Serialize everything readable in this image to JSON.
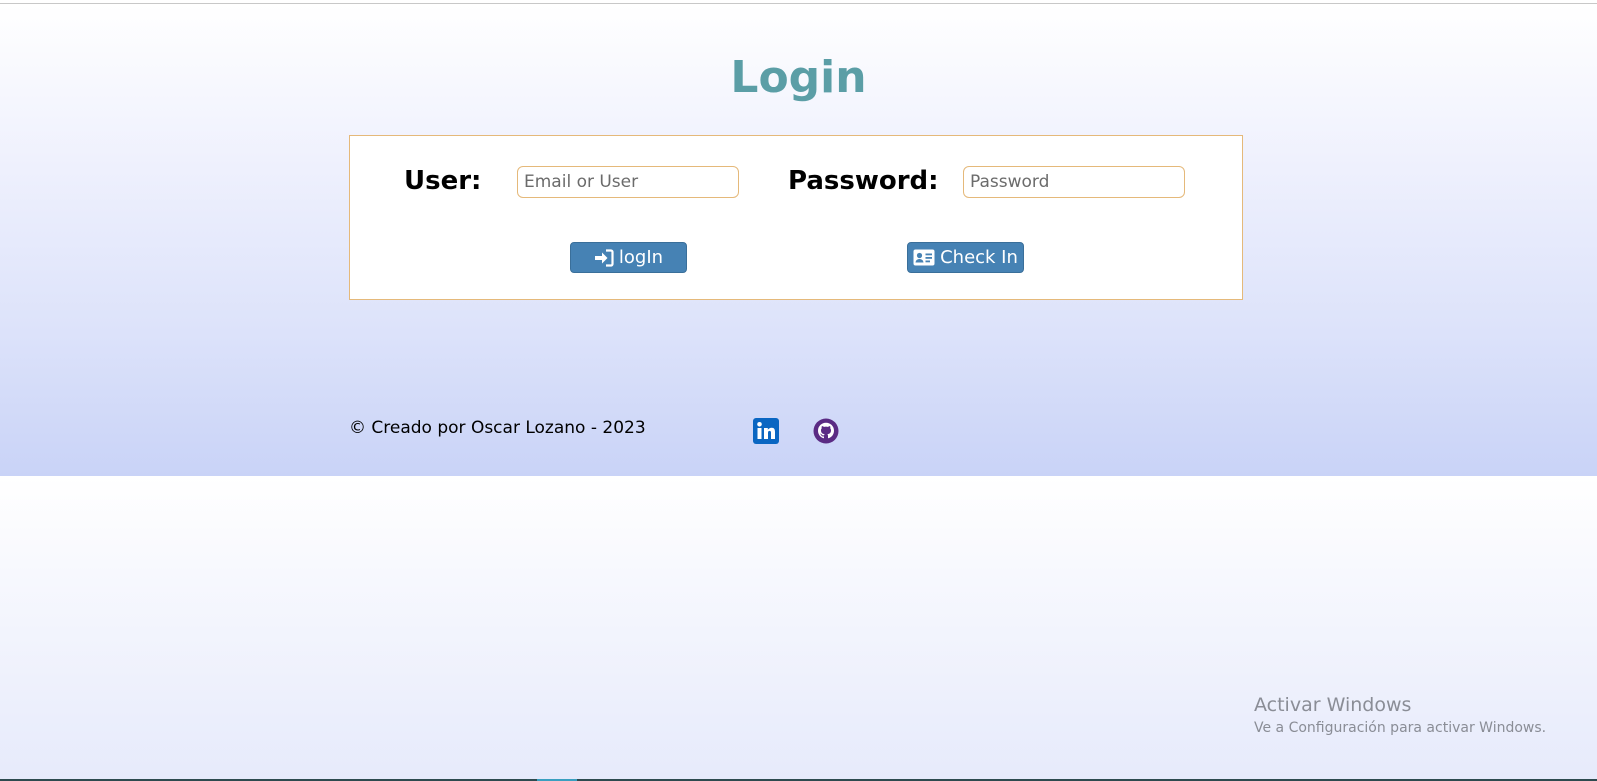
{
  "header": {
    "title": "Login"
  },
  "form": {
    "user_label": "User:",
    "user_placeholder": "Email or User",
    "user_value": "",
    "password_label": "Password:",
    "password_placeholder": "Password",
    "password_value": "",
    "login_button": "logIn",
    "login_icon": "sign-in-icon",
    "checkin_button": "Check In",
    "checkin_icon": "id-card-icon"
  },
  "footer": {
    "credit": "© Creado por Oscar Lozano - 2023",
    "linkedin_icon": "linkedin-icon",
    "github_icon": "github-icon"
  },
  "watermark": {
    "title": "Activar Windows",
    "subtitle": "Ve a Configuración para activar Windows."
  },
  "colors": {
    "title": "#5b9ea6",
    "button": "#4682b4",
    "card_border": "#e5b97a",
    "linkedin": "#0a66c2",
    "github": "#5b2b84"
  }
}
